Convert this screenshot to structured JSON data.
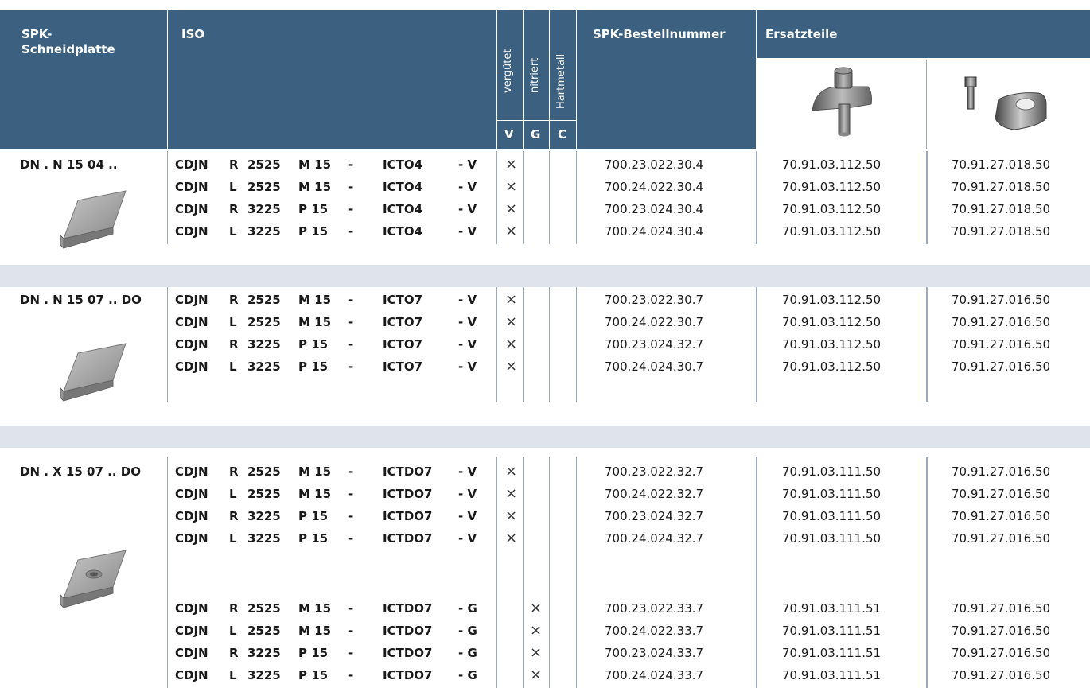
{
  "header": {
    "spk_label": "SPK-\nSchneidplatte",
    "iso_label": "ISO",
    "col_v_rot": "vergütet",
    "col_g_rot": "nitriert",
    "col_c_rot": "Hartmetall",
    "col_v": "V",
    "col_g": "G",
    "col_c": "C",
    "order_label": "SPK-Bestellnummer",
    "parts_label": "Ersatzteile"
  },
  "icons": {
    "clamp": "clamp-screw-icon",
    "screw_shim": "screw-and-shim-icon",
    "insert_plain": "rhombic-insert-icon",
    "insert_hole": "rhombic-insert-with-hole-icon",
    "cross": "×"
  },
  "colors": {
    "header": "#3c6180",
    "separator": "#dfe4ec",
    "grid": "#9aaabb"
  },
  "groups": [
    {
      "name": "DN . N 15 04 ..",
      "rows": [
        {
          "a": "CDJN",
          "b": "R",
          "c": "2525",
          "d": "M 15",
          "e": "-",
          "f": "ICTO4",
          "g": "- V",
          "v": "×",
          "gg": "",
          "order": "700.23.022.30.4",
          "p1": "70.91.03.112.50",
          "p2": "70.91.27.018.50"
        },
        {
          "a": "CDJN",
          "b": "L",
          "c": "2525",
          "d": "M 15",
          "e": "-",
          "f": "ICTO4",
          "g": "- V",
          "v": "×",
          "gg": "",
          "order": "700.24.022.30.4",
          "p1": "70.91.03.112.50",
          "p2": "70.91.27.018.50"
        },
        {
          "a": "CDJN",
          "b": "R",
          "c": "3225",
          "d": "P 15",
          "e": "-",
          "f": "ICTO4",
          "g": "- V",
          "v": "×",
          "gg": "",
          "order": "700.23.024.30.4",
          "p1": "70.91.03.112.50",
          "p2": "70.91.27.018.50"
        },
        {
          "a": "CDJN",
          "b": "L",
          "c": "3225",
          "d": "P 15",
          "e": "-",
          "f": "ICTO4",
          "g": "- V",
          "v": "×",
          "gg": "",
          "order": "700.24.024.30.4",
          "p1": "70.91.03.112.50",
          "p2": "70.91.27.018.50"
        }
      ]
    },
    {
      "name": "DN . N 15 07 .. DO",
      "rows": [
        {
          "a": "CDJN",
          "b": "R",
          "c": "2525",
          "d": "M 15",
          "e": "-",
          "f": "ICTO7",
          "g": "- V",
          "v": "×",
          "gg": "",
          "order": "700.23.022.30.7",
          "p1": "70.91.03.112.50",
          "p2": "70.91.27.016.50"
        },
        {
          "a": "CDJN",
          "b": "L",
          "c": "2525",
          "d": "M 15",
          "e": "-",
          "f": "ICTO7",
          "g": "- V",
          "v": "×",
          "gg": "",
          "order": "700.24.022.30.7",
          "p1": "70.91.03.112.50",
          "p2": "70.91.27.016.50"
        },
        {
          "a": "CDJN",
          "b": "R",
          "c": "3225",
          "d": "P 15",
          "e": "-",
          "f": "ICTO7",
          "g": "- V",
          "v": "×",
          "gg": "",
          "order": "700.23.024.32.7",
          "p1": "70.91.03.112.50",
          "p2": "70.91.27.016.50"
        },
        {
          "a": "CDJN",
          "b": "L",
          "c": "3225",
          "d": "P 15",
          "e": "-",
          "f": "ICTO7",
          "g": "- V",
          "v": "×",
          "gg": "",
          "order": "700.24.024.30.7",
          "p1": "70.91.03.112.50",
          "p2": "70.91.27.016.50"
        }
      ]
    },
    {
      "name": "DN . X 15 07 .. DO",
      "rows": [
        {
          "a": "CDJN",
          "b": "R",
          "c": "2525",
          "d": "M 15",
          "e": "-",
          "f": "ICTDO7",
          "g": "- V",
          "v": "×",
          "gg": "",
          "order": "700.23.022.32.7",
          "p1": "70.91.03.111.50",
          "p2": "70.91.27.016.50"
        },
        {
          "a": "CDJN",
          "b": "L",
          "c": "2525",
          "d": "M 15",
          "e": "-",
          "f": "ICTDO7",
          "g": "- V",
          "v": "×",
          "gg": "",
          "order": "700.24.022.32.7",
          "p1": "70.91.03.111.50",
          "p2": "70.91.27.016.50"
        },
        {
          "a": "CDJN",
          "b": "R",
          "c": "3225",
          "d": "P 15",
          "e": "-",
          "f": "ICTDO7",
          "g": "- V",
          "v": "×",
          "gg": "",
          "order": "700.23.024.32.7",
          "p1": "70.91.03.111.50",
          "p2": "70.91.27.016.50"
        },
        {
          "a": "CDJN",
          "b": "L",
          "c": "3225",
          "d": "P 15",
          "e": "-",
          "f": "ICTDO7",
          "g": "- V",
          "v": "×",
          "gg": "",
          "order": "700.24.024.32.7",
          "p1": "70.91.03.111.50",
          "p2": "70.91.27.016.50"
        },
        {
          "a": "CDJN",
          "b": "R",
          "c": "2525",
          "d": "M 15",
          "e": "-",
          "f": "ICTDO7",
          "g": "- G",
          "v": "",
          "gg": "×",
          "order": "700.23.022.33.7",
          "p1": "70.91.03.111.51",
          "p2": "70.91.27.016.50"
        },
        {
          "a": "CDJN",
          "b": "L",
          "c": "2525",
          "d": "M 15",
          "e": "-",
          "f": "ICTDO7",
          "g": "- G",
          "v": "",
          "gg": "×",
          "order": "700.24.022.33.7",
          "p1": "70.91.03.111.51",
          "p2": "70.91.27.016.50"
        },
        {
          "a": "CDJN",
          "b": "R",
          "c": "3225",
          "d": "P 15",
          "e": "-",
          "f": "ICTDO7",
          "g": "- G",
          "v": "",
          "gg": "×",
          "order": "700.23.024.33.7",
          "p1": "70.91.03.111.51",
          "p2": "70.91.27.016.50"
        },
        {
          "a": "CDJN",
          "b": "L",
          "c": "3225",
          "d": "P 15",
          "e": "-",
          "f": "ICTDO7",
          "g": "- G",
          "v": "",
          "gg": "×",
          "order": "700.24.024.33.7",
          "p1": "70.91.03.111.51",
          "p2": "70.91.27.016.50"
        }
      ]
    }
  ]
}
